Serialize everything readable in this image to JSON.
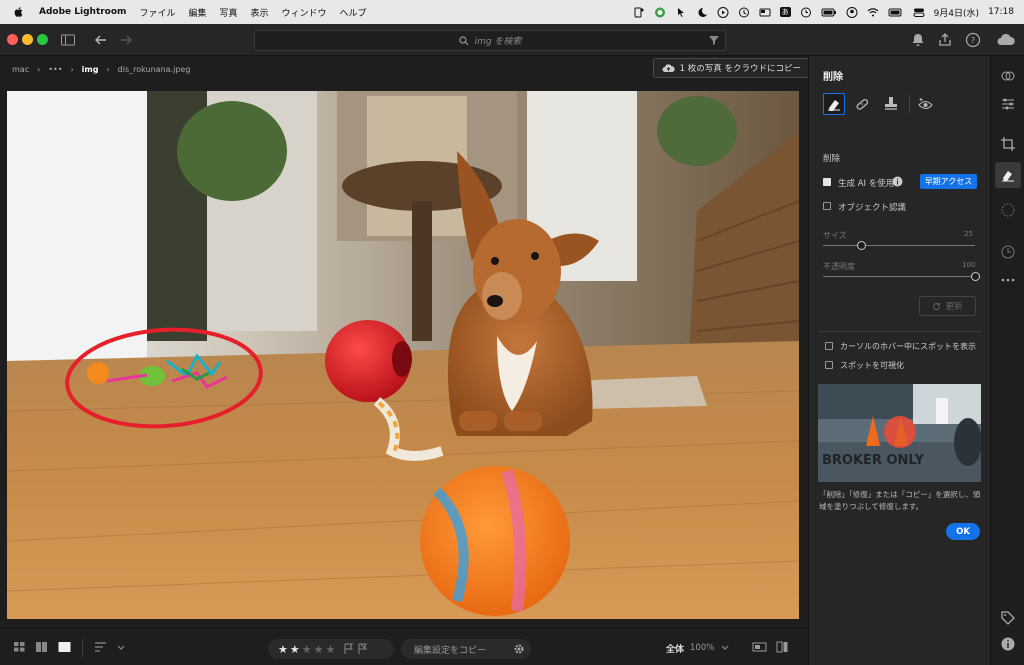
{
  "menubar": {
    "app_name": "Adobe Lightroom",
    "items": [
      "ファイル",
      "編集",
      "写真",
      "表示",
      "ウィンドウ",
      "ヘルプ"
    ],
    "input_mode": "あ",
    "date": "9月4日(水)",
    "time": "17:18"
  },
  "window": {
    "search_placeholder": "img を検索"
  },
  "breadcrumb": {
    "items": [
      "mac",
      "•••",
      "img",
      "dis_rokunana.jpeg"
    ],
    "copy_to_cloud": "1 枚の写真 をクラウドにコピー"
  },
  "bottombar": {
    "rating_stars": 2,
    "rating_max": 5,
    "copy_edits": "編集設定をコピー",
    "zoom_label": "全体",
    "zoom_value": "100%"
  },
  "panel": {
    "title": "削除",
    "section_label": "削除",
    "gen_ai_label": "生成 AI を使用",
    "gen_ai_checked": true,
    "early_access": "早期アクセス",
    "object_detect_label": "オブジェクト認識",
    "object_detect_checked": false,
    "size_label": "サイズ",
    "size_value": "25",
    "size_fraction": 0.25,
    "opacity_label": "不透明度",
    "opacity_value": "100",
    "opacity_fraction": 1.0,
    "refresh_label": "更新",
    "show_spot_hover": "カーソルのホバー中にスポットを表示",
    "visualize_spots": "スポットを可視化",
    "help_image_text": "BROKER ONLY",
    "help_text": "「削除」「修復」または「コピー」を選択し、領域を塗りつぶして修復します。",
    "ok_label": "OK"
  },
  "colors": {
    "accent": "#1473e6",
    "annotation_circle": "#e5202a"
  }
}
